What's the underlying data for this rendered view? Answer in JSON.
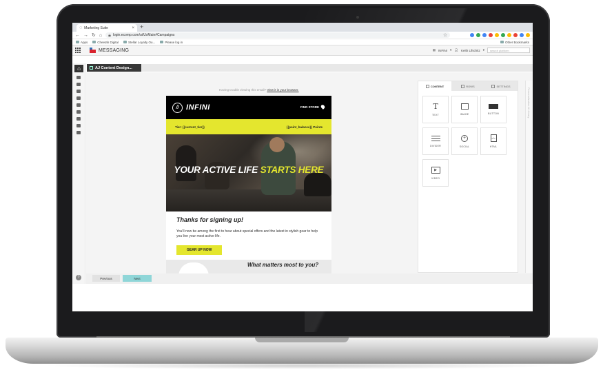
{
  "browser": {
    "tab_title": "Marketing Suite",
    "tab_close": "×",
    "new_tab": "+",
    "url": "login.ecomp.com/ui/UxMain#Campaigns",
    "bookmarks": [
      "Apps",
      "Cheetah Digital",
      "Stellar Loyalty Ou...",
      "Please log in"
    ],
    "other_bookmarks": "Other Bookmarks",
    "extension_colors": [
      "#4285f4",
      "#34a853",
      "#4285f4",
      "#ea4335",
      "#fbbc05",
      "#34a853",
      "#fbbc05",
      "#ea4335",
      "#4285f4",
      "#fbbc05"
    ]
  },
  "app": {
    "title": "MESSAGING",
    "account": "INFINI",
    "user": "Keith Lifschitz",
    "search_placeholder": "search platform",
    "breadcrumb": "AJ Content Design..."
  },
  "email": {
    "trouble_prefix": "Having trouble viewing this email?",
    "trouble_link": "View it in your browser.",
    "logo_mark": "//",
    "logo_text": "INFINI",
    "find_store": "FIND STORE",
    "tier": "Tier: {{current_tier}}",
    "points": "{{point_balance}} Points",
    "hero_part1": "YOUR ACTIVE LIFE ",
    "hero_part2": "STARTS HERE",
    "thanks": "Thanks for signing up!",
    "body": "You'll now be among the first to hear about special offers and the latest in stylish gear to help you live your most active life.",
    "cta": "GEAR UP NOW",
    "footer_question": "What matters most to you?"
  },
  "panel": {
    "tabs": [
      "CONTENT",
      "ROWS",
      "SETTINGS"
    ],
    "tiles": [
      "TEXT",
      "IMAGE",
      "BUTTON",
      "DIVIDER",
      "SOCIAL",
      "HTML",
      "VIDEO"
    ],
    "side_label": "Personalization & Library"
  },
  "nav": {
    "previous": "Previous",
    "next": "Next",
    "help": "?"
  },
  "colors": {
    "brand_yellow": "#e4e62e",
    "next_button": "#8fd6d8",
    "breadcrumb_bg": "#383838"
  }
}
